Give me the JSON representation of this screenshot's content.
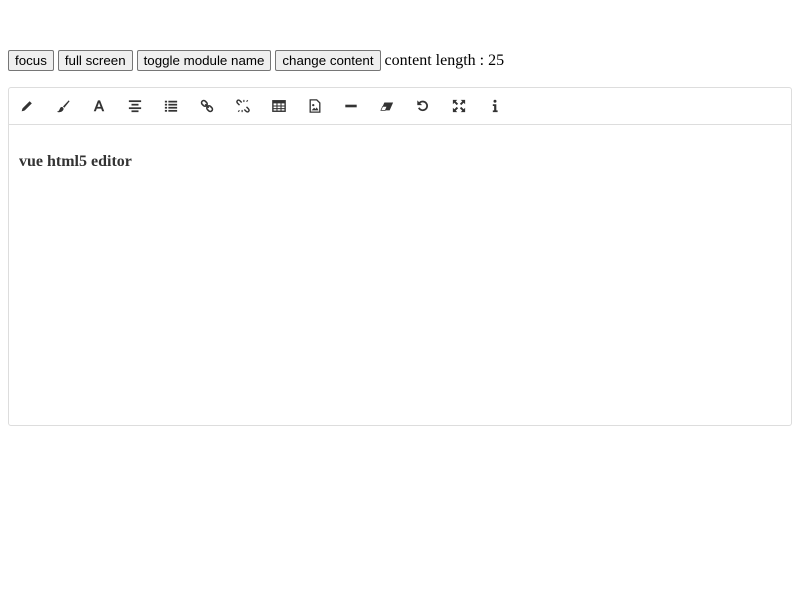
{
  "controls": {
    "focus_label": "focus",
    "fullscreen_label": "full screen",
    "toggle_module_name_label": "toggle module name",
    "change_content_label": "change content",
    "content_length_label": "content length : ",
    "content_length_value": "25"
  },
  "toolbar": {
    "icons": [
      "pencil-icon",
      "brush-icon",
      "font-icon",
      "align-icon",
      "list-icon",
      "link-icon",
      "unlink-icon",
      "table-icon",
      "image-icon",
      "hr-icon",
      "eraser-icon",
      "undo-icon",
      "fullscreen-icon",
      "info-icon"
    ],
    "icon_color": "#333333"
  },
  "editor": {
    "content": "vue html5 editor"
  }
}
